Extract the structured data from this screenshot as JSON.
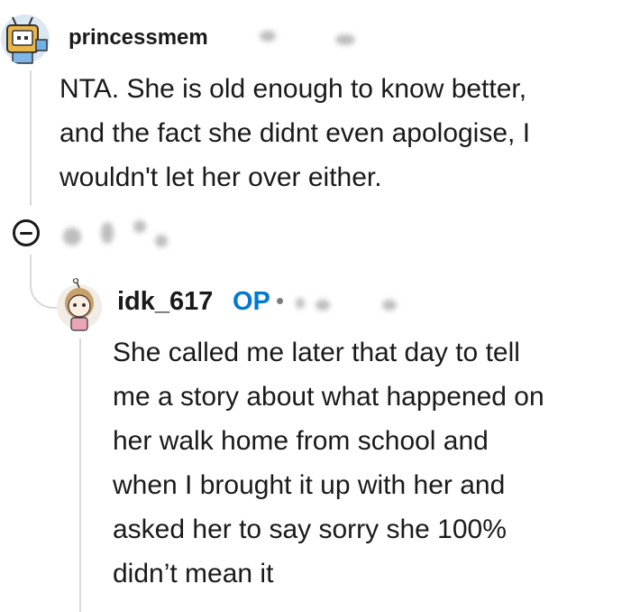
{
  "comment": {
    "username": "princessmem",
    "body_lines": [
      "NTA. She is old enough to know better,",
      "and the fact she didnt even apologise, I",
      "wouldn't let her over either."
    ]
  },
  "reply": {
    "username": "idk_617",
    "badge": "OP",
    "separator": "•",
    "body_lines": [
      "She called me later that day to tell",
      "me a story about what happened on",
      "her walk home from school and",
      "when I brought it up with her and",
      "asked her to say sorry she 100%",
      "didn’t mean it"
    ]
  },
  "icons": {
    "collapse": "minus-circle-icon",
    "avatar": "snoo-avatar-icon"
  },
  "colors": {
    "op_badge": "#0079d3",
    "thread_line": "#d9d9d9",
    "text": "#1a1a1b"
  }
}
